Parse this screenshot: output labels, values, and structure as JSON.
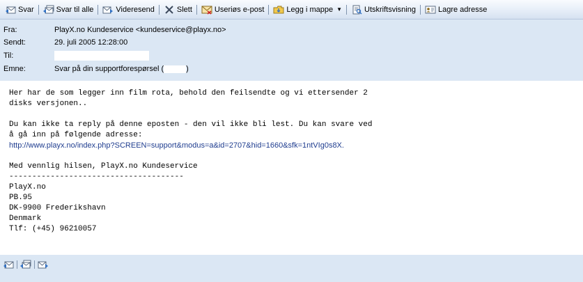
{
  "toolbar": {
    "reply": {
      "label": "Svar",
      "icon": "reply-icon"
    },
    "reply_all": {
      "label": "Svar til alle",
      "icon": "reply-all-icon"
    },
    "forward": {
      "label": "Videresend",
      "icon": "forward-icon"
    },
    "delete": {
      "label": "Slett",
      "icon": "delete-icon"
    },
    "spam": {
      "label": "Useriøs e-post",
      "icon": "spam-envelope-icon"
    },
    "move": {
      "label": "Legg i mappe",
      "icon": "folder-icon"
    },
    "print": {
      "label": "Utskriftsvisning",
      "icon": "print-preview-icon"
    },
    "save_address": {
      "label": "Lagre adresse",
      "icon": "address-card-icon"
    }
  },
  "header": {
    "from_label": "Fra:",
    "from_value": "PlayX.no Kundeservice <kundeservice@playx.no>",
    "sent_label": "Sendt:",
    "sent_value": "29. juli 2005 12:28:00",
    "to_label": "Til:",
    "subject_label": "Emne:",
    "subject_prefix": "Svar på din supportforespørsel (",
    "subject_suffix": ")"
  },
  "body": {
    "para1": "Her har de som legger inn film rota, behold den feilsendte og vi ettersender 2\ndisks versjonen..",
    "para2": "Du kan ikke ta reply på denne eposten - den vil ikke bli lest. Du kan svare ved\nå gå inn på følgende adresse:",
    "link": "http://www.playx.no/index.php?SCREEN=support&modus=a&id=2707&hid=1660&sfk=1ntVIg0s8X.",
    "signature": "Med vennlig hilsen, PlayX.no Kundeservice\n--------------------------------------\nPlayX.no\nPB.95\nDK-9900 Frederikshavn\nDenmark\nTlf: (+45) 96210057"
  },
  "colors": {
    "panel_bg": "#dbe7f4",
    "link": "#1f3d8f"
  }
}
